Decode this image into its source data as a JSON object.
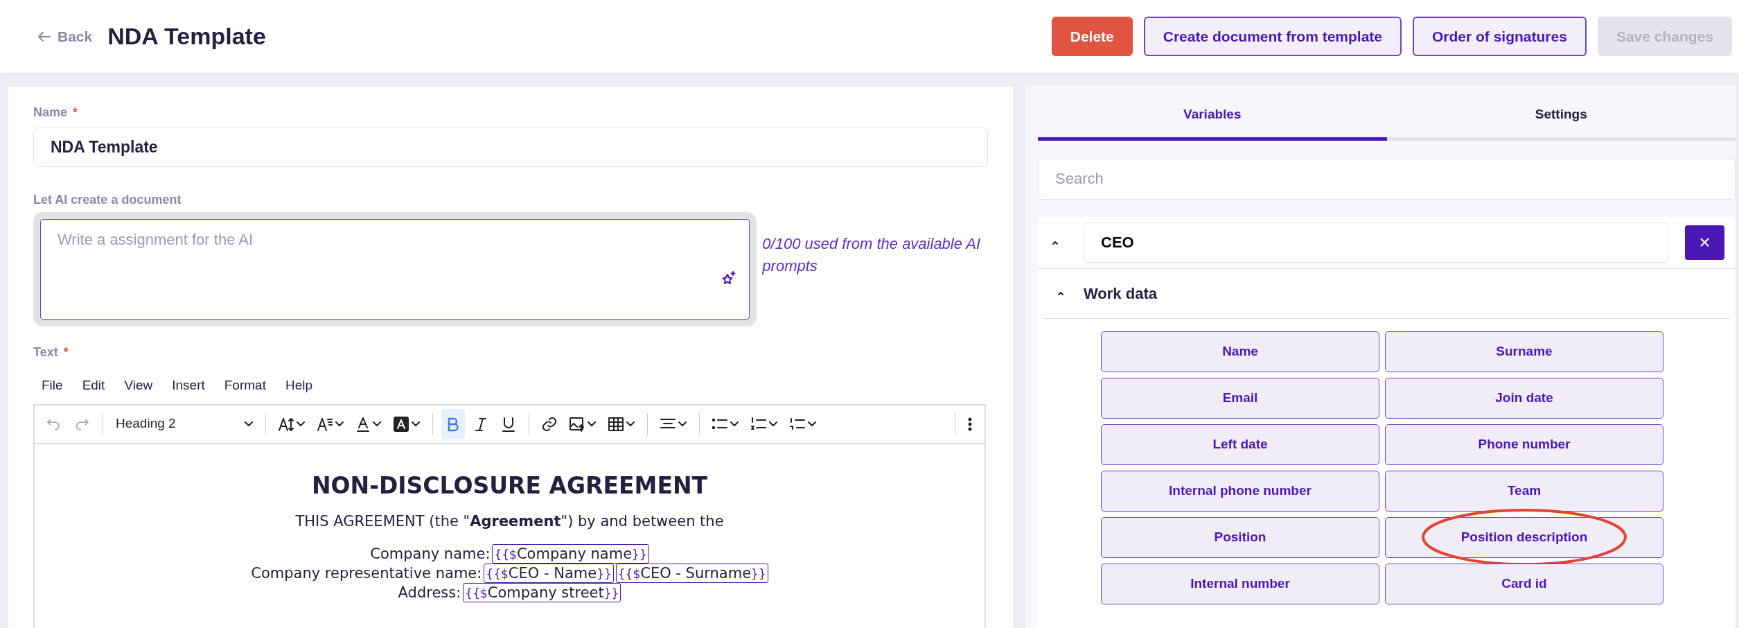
{
  "header": {
    "back": "Back",
    "title": "NDA Template",
    "buttons": [
      {
        "kind": "danger",
        "label": "Delete",
        "disabled": false
      },
      {
        "kind": "outline",
        "label": "Create document from template",
        "disabled": false
      },
      {
        "kind": "outline",
        "label": "Order of signatures",
        "disabled": false
      },
      {
        "kind": "outline",
        "label": "Save changes",
        "disabled": true
      }
    ]
  },
  "form": {
    "required_mark": "*",
    "name_label": "Name",
    "name_required": true,
    "name_value": "NDA Template",
    "ai_label": "Let AI create a document",
    "ai_placeholder": "Write a assignment for the AI",
    "ai_usage": "0/100 used from the available AI prompts",
    "text_label": "Text",
    "text_required": true
  },
  "editor": {
    "menu": [
      "File",
      "Edit",
      "View",
      "Insert",
      "Format",
      "Help"
    ],
    "block_format": "Heading 2",
    "bold_active": true,
    "heading": "NON-DISCLOSURE AGREEMENT",
    "intro": "THIS AGREEMENT (the \"**Agreement**\") by and between the",
    "lines": [
      {
        "label": "Company name:",
        "tags": [
          "Company name"
        ]
      },
      {
        "label": "Company representative name:",
        "tags": [
          "CEO - Name",
          "CEO - Surname"
        ]
      },
      {
        "label": "Address:",
        "tags": [
          "Company street"
        ]
      }
    ],
    "tag_open": "{{$",
    "tag_close": "}}"
  },
  "panel": {
    "tabs": [
      {
        "label": "Variables",
        "selected": true
      },
      {
        "label": "Settings",
        "selected": false
      }
    ],
    "search_placeholder": "Search",
    "group": {
      "value": "CEO",
      "expanded": true,
      "close": "×",
      "section": {
        "title": "Work data",
        "expanded": true,
        "variables": [
          {
            "label": "Name",
            "highlighted": false
          },
          {
            "label": "Surname",
            "highlighted": false
          },
          {
            "label": "Email",
            "highlighted": false
          },
          {
            "label": "Join date",
            "highlighted": false
          },
          {
            "label": "Left date",
            "highlighted": false
          },
          {
            "label": "Phone number",
            "highlighted": false
          },
          {
            "label": "Internal phone number",
            "highlighted": false
          },
          {
            "label": "Team",
            "highlighted": false
          },
          {
            "label": "Position",
            "highlighted": false
          },
          {
            "label": "Position description",
            "highlighted": true
          },
          {
            "label": "Internal number",
            "highlighted": false
          },
          {
            "label": "Card id",
            "highlighted": false
          }
        ]
      }
    }
  }
}
